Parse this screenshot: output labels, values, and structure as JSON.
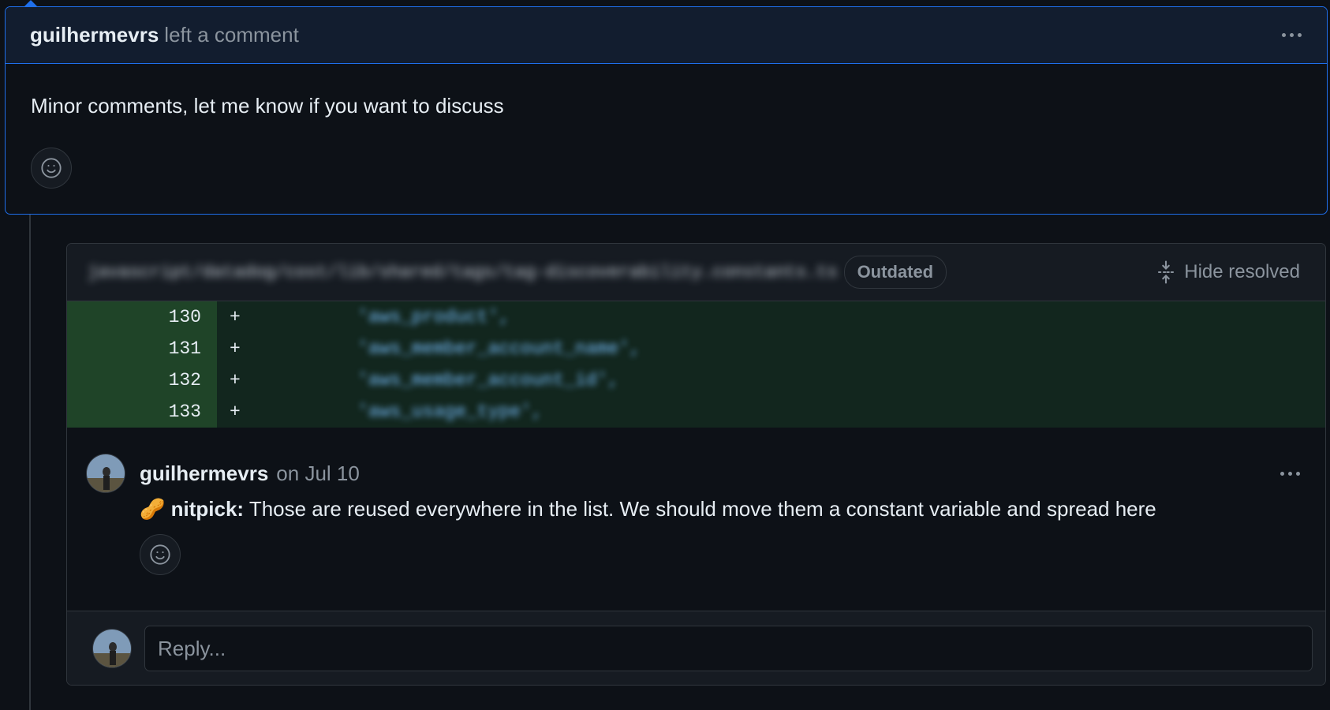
{
  "review": {
    "author": "guilhermevrs",
    "action": "left a comment",
    "body": "Minor comments, let me know if you want to discuss"
  },
  "thread": {
    "file_path": "javascript/datadog/cost/lib/shared/tags/tag-discoverability.constants.ts",
    "badge": "Outdated",
    "hide_label": "Hide resolved",
    "diff_lines": [
      {
        "num": "130",
        "marker": "+",
        "code": "'aws_product',"
      },
      {
        "num": "131",
        "marker": "+",
        "code": "'aws_member_account_name',"
      },
      {
        "num": "132",
        "marker": "+",
        "code": "'aws_member_account_id',"
      },
      {
        "num": "133",
        "marker": "+",
        "code": "'aws_usage_type',"
      }
    ]
  },
  "comment": {
    "author": "guilhermevrs",
    "date": "on Jul 10",
    "emoji": "🥜",
    "label": "nitpick:",
    "text": " Those are reused everywhere in the list. We should move them a constant variable and spread here"
  },
  "reply": {
    "placeholder": "Reply..."
  }
}
